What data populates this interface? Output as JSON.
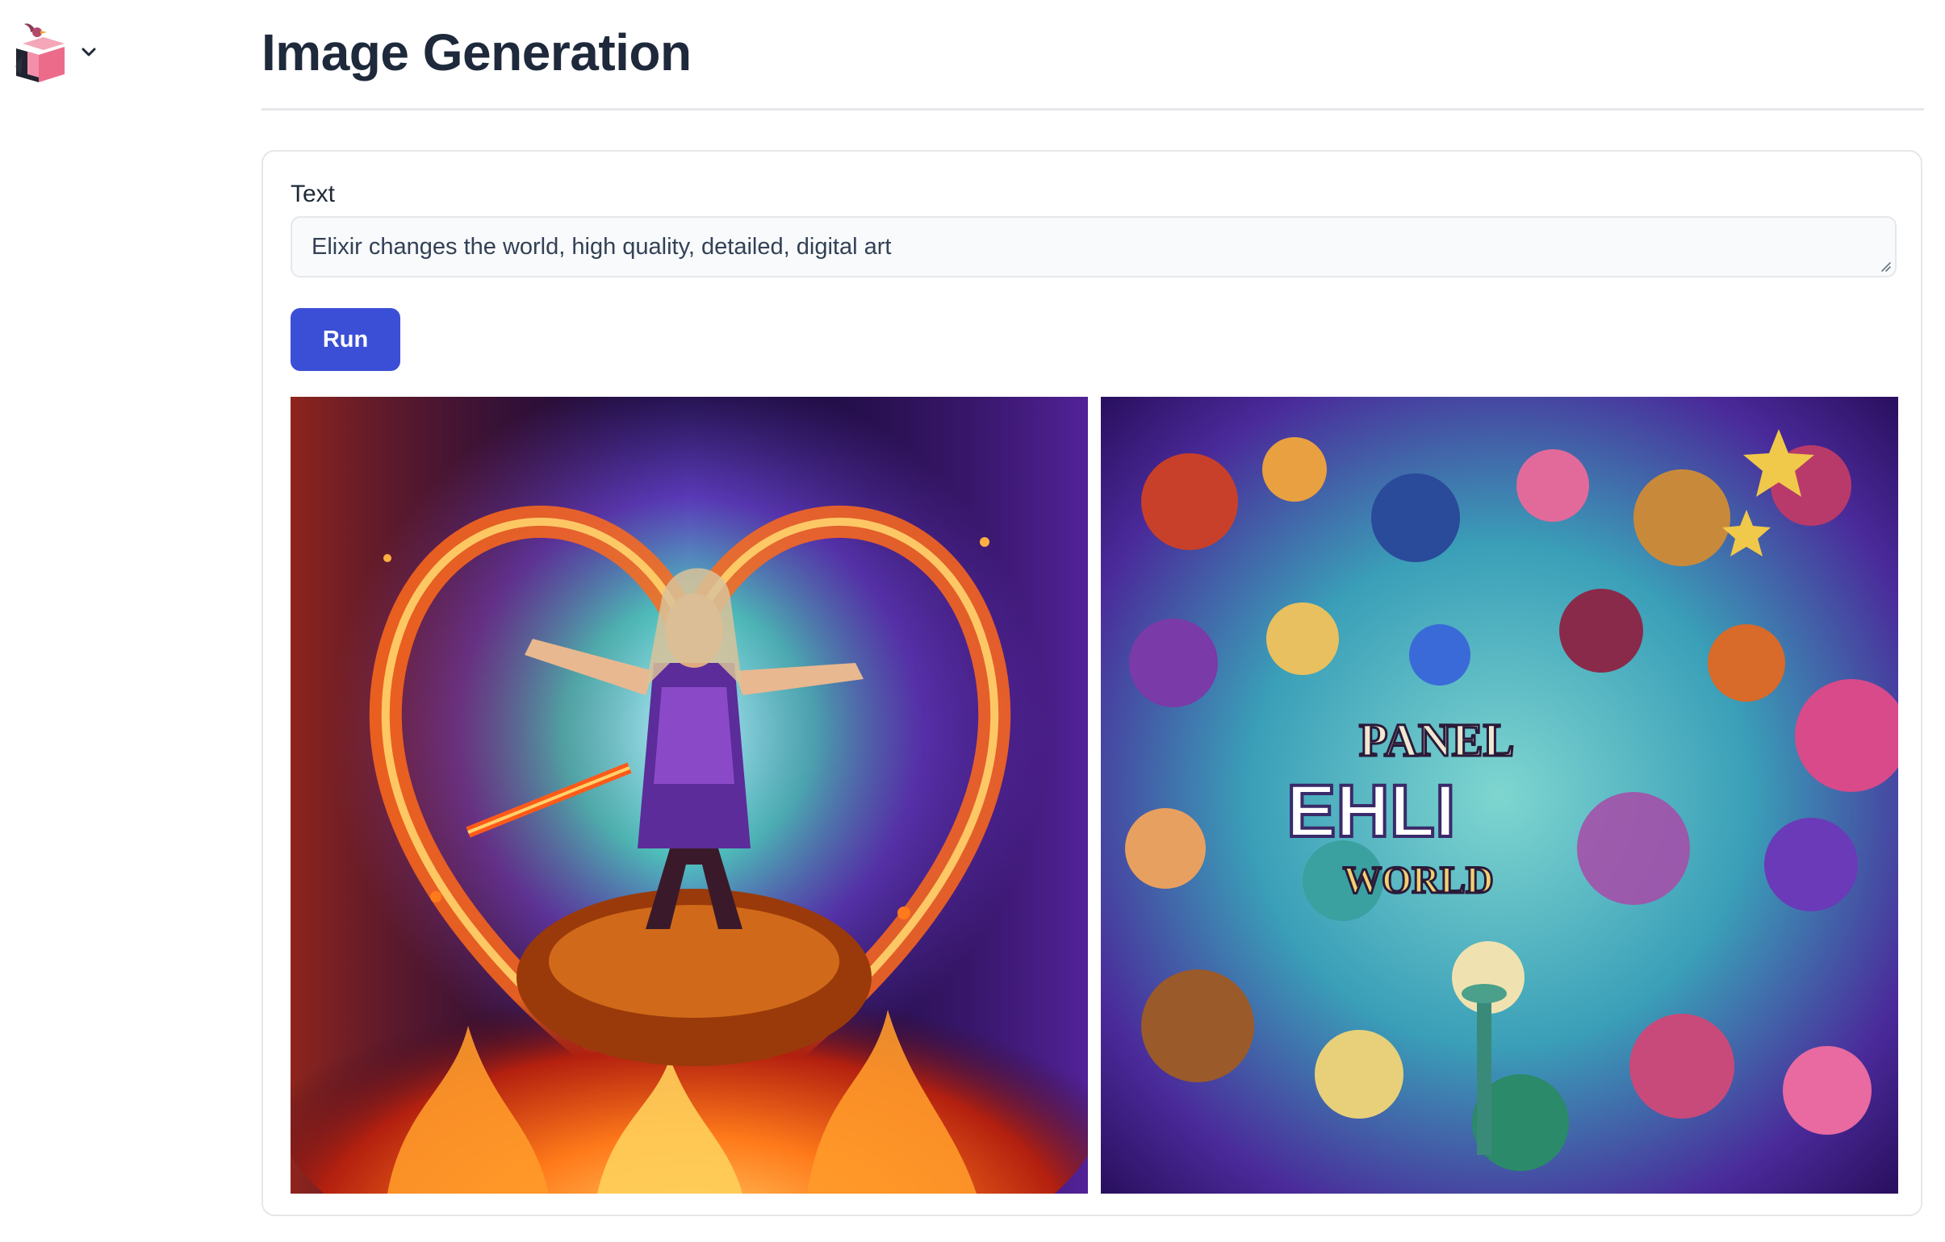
{
  "header": {
    "logo_icon": "livebook-logo-icon",
    "menu_icon": "chevron-down-icon"
  },
  "page": {
    "title": "Image Generation"
  },
  "form": {
    "text_label": "Text",
    "text_value": "Elixir changes the world, high quality, detailed, digital art",
    "run_label": "Run"
  },
  "output": {
    "images": [
      {
        "subject": "fantasy warrior surrounded by fire and magical energy"
      },
      {
        "subject": "colorful collage of fantastical objects with stylized lettering"
      }
    ],
    "image2_lettering": [
      "PANEL",
      "EHLI",
      "WORLD"
    ]
  },
  "colors": {
    "accent": "#3b4fd6",
    "title": "#1e293b",
    "border": "#e5e7eb",
    "input_bg": "#f8fafc"
  }
}
